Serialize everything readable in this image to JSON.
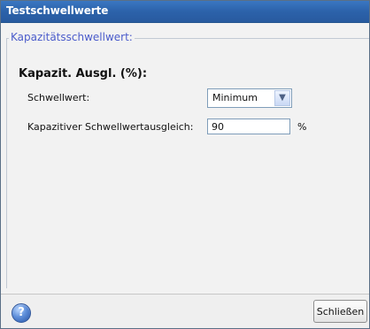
{
  "window": {
    "title": "Testschwellwerte"
  },
  "group": {
    "legend": "Kapazitätsschwellwert:"
  },
  "section": {
    "title": "Kapazit. Ausgl. (%):"
  },
  "fields": {
    "threshold_label": "Schwellwert:",
    "threshold_value": "Minimum",
    "compensation_label": "Kapazitiver Schwellwertausgleich:",
    "compensation_value": "90",
    "compensation_unit": "%"
  },
  "footer": {
    "help_label": "?",
    "close_label": "Schließen"
  },
  "icons": {
    "help": "help-icon",
    "dropdown": "chevron-down-icon"
  },
  "colors": {
    "title_bar": "#2c62aa",
    "legend_text": "#4b5ccb",
    "window_bg": "#f2f2f2"
  }
}
